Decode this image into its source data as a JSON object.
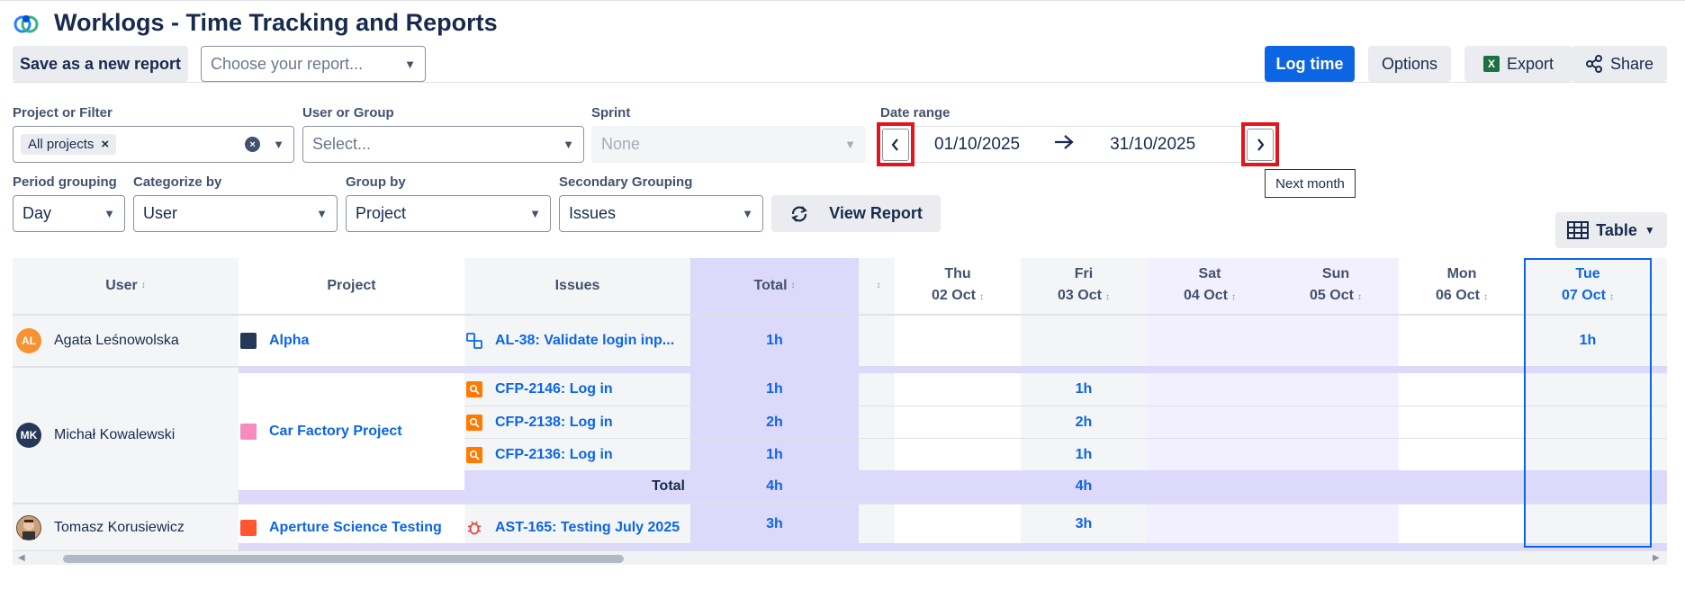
{
  "app": {
    "title": "Worklogs - Time Tracking and Reports"
  },
  "toolbar": {
    "save_report": "Save as a new report",
    "choose_report_placeholder": "Choose your report...",
    "log_time": "Log time",
    "options": "Options",
    "export": "Export",
    "share": "Share"
  },
  "filters": {
    "project_label": "Project or Filter",
    "project_chip": "All projects",
    "user_label": "User or Group",
    "user_placeholder": "Select...",
    "sprint_label": "Sprint",
    "sprint_value": "None",
    "date_label": "Date range",
    "date_from": "01/10/2025",
    "date_to": "31/10/2025",
    "tooltip_next": "Next month",
    "period_label": "Period grouping",
    "period_value": "Day",
    "categorize_label": "Categorize by",
    "categorize_value": "User",
    "groupby_label": "Group by",
    "groupby_value": "Project",
    "secondary_label": "Secondary Grouping",
    "secondary_value": "Issues",
    "view_report": "View Report",
    "view_mode": "Table"
  },
  "table": {
    "headers": {
      "user": "User",
      "project": "Project",
      "issues": "Issues",
      "total": "Total"
    },
    "days": [
      {
        "dow": "Thu",
        "date": "02 Oct"
      },
      {
        "dow": "Fri",
        "date": "03 Oct"
      },
      {
        "dow": "Sat",
        "date": "04 Oct"
      },
      {
        "dow": "Sun",
        "date": "05 Oct"
      },
      {
        "dow": "Mon",
        "date": "06 Oct"
      },
      {
        "dow": "Tue",
        "date": "07 Oct"
      }
    ],
    "rows": [
      {
        "initials": "AL",
        "user": "Agata Leśnowolska",
        "project": "Alpha",
        "issue": "AL-38: Validate login inp...",
        "total": "1h",
        "tue": "1h"
      },
      {
        "initials": "MK",
        "user": "Michał Kowalewski",
        "project": "Car Factory Project",
        "issues": [
          {
            "issue": "CFP-2146: Log in",
            "total": "1h",
            "fri": "1h"
          },
          {
            "issue": "CFP-2138: Log in",
            "total": "2h",
            "fri": "2h"
          },
          {
            "issue": "CFP-2136: Log in",
            "total": "1h",
            "fri": "1h"
          }
        ],
        "total_label": "Total",
        "total": "4h",
        "fri_total": "4h"
      },
      {
        "user": "Tomasz Korusiewicz",
        "project": "Aperture Science Testing",
        "issue": "AST-165: Testing July 2025",
        "total": "3h",
        "fri": "3h"
      }
    ]
  },
  "colors": {
    "accent": "#0c66e4",
    "total_column": "#dcd9fb",
    "weekend": "#f2f0fe",
    "highlight_border": "#0c66e4",
    "red_outline": "#e2141c"
  }
}
